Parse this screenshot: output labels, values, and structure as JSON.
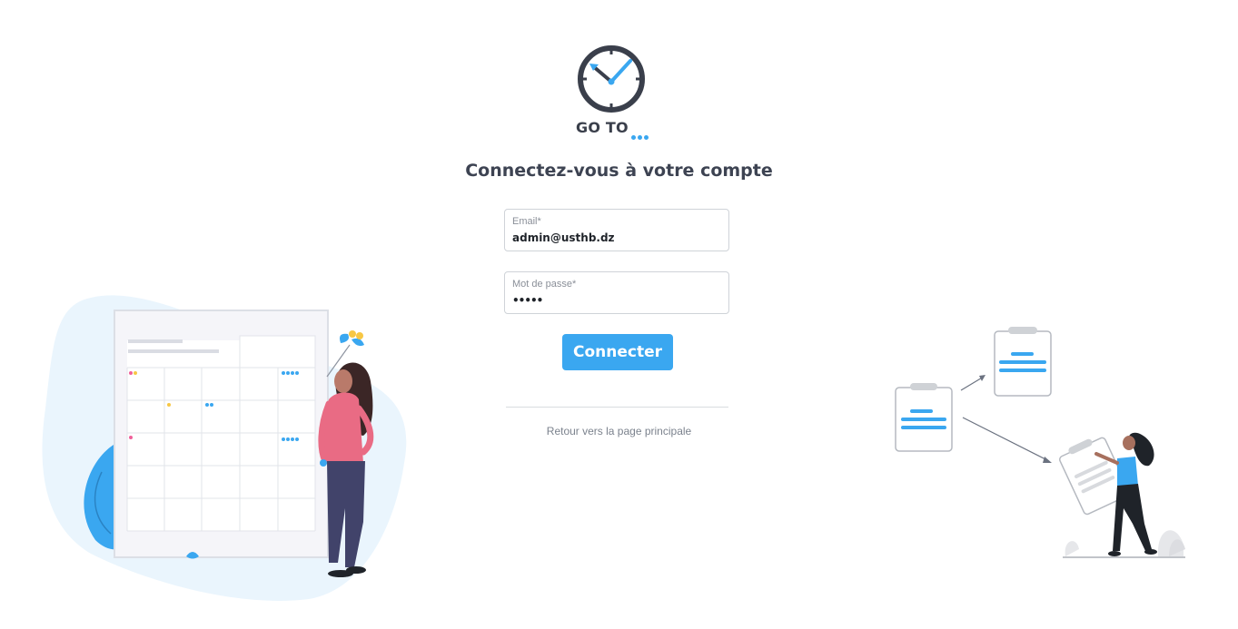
{
  "brand": {
    "name": "GO TO",
    "icon": "clock-icon",
    "accent": "#3aa7f0"
  },
  "login": {
    "title": "Connectez-vous à votre compte",
    "email": {
      "label": "Email*",
      "value": "admin@usthb.dz"
    },
    "password": {
      "label": "Mot de passe*",
      "value": "•••••"
    },
    "submit_label": "Connecter",
    "back_link": "Retour vers la page principale"
  },
  "illustrations": {
    "left": "calendar-woman-illustration",
    "right": "task-clipboards-illustration"
  }
}
